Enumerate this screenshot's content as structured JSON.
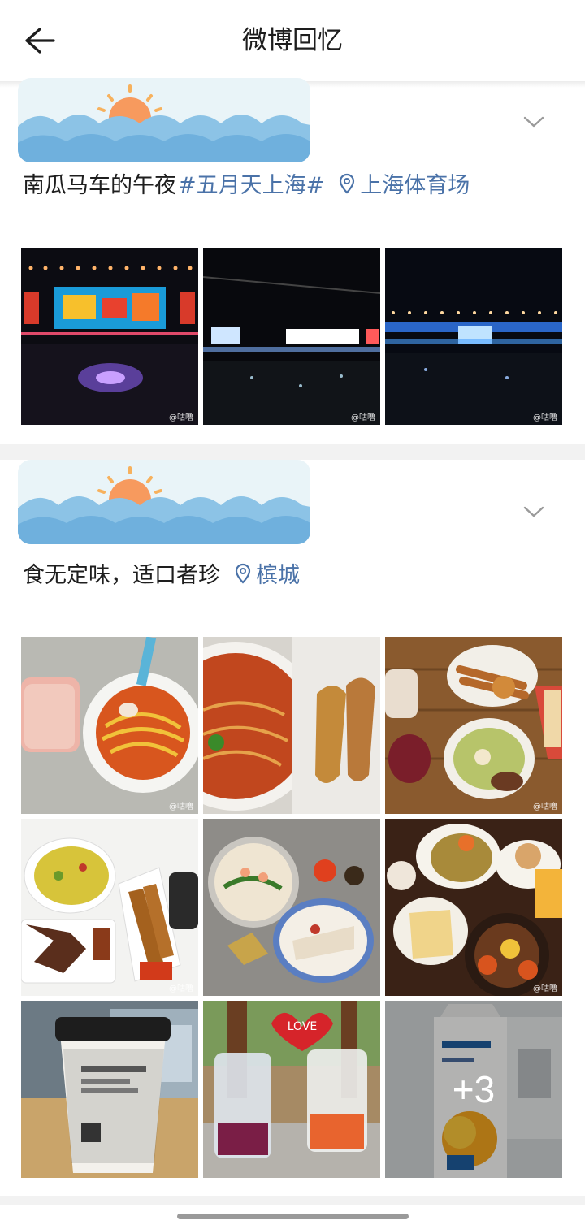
{
  "header": {
    "title": "微博回忆",
    "back_icon": "arrow-left-icon"
  },
  "posts": [
    {
      "text": "南瓜马车的午夜",
      "topic": "#五月天上海#",
      "location": "上海体育场",
      "photos": [
        {
          "desc": "concert stage with colorful screen",
          "watermark": "@咕噜"
        },
        {
          "desc": "concert stage with light bars",
          "watermark": "@咕噜"
        },
        {
          "desc": "concert stage blue lights",
          "watermark": "@咕噜"
        }
      ]
    },
    {
      "text": "食无定味，适口者珍",
      "location": "槟城",
      "photos": [
        {
          "desc": "noodle soup and pink drink",
          "watermark": "@咕噜"
        },
        {
          "desc": "laksa and fried fish"
        },
        {
          "desc": "satay and curry",
          "watermark": "@咕噜"
        },
        {
          "desc": "rice, wings and skewers",
          "watermark": "@咕噜"
        },
        {
          "desc": "noodle soup and chicken rice"
        },
        {
          "desc": "nasi and seafood",
          "watermark": "@咕噜"
        },
        {
          "desc": "takeaway coffee cup"
        },
        {
          "desc": "iced drinks with LOVE sign",
          "sign": "LOVE"
        },
        {
          "desc": "mango yogurt carton",
          "more": "+3"
        }
      ]
    }
  ],
  "colors": {
    "link": "#4a72a8",
    "divider": "#f2f2f2"
  }
}
